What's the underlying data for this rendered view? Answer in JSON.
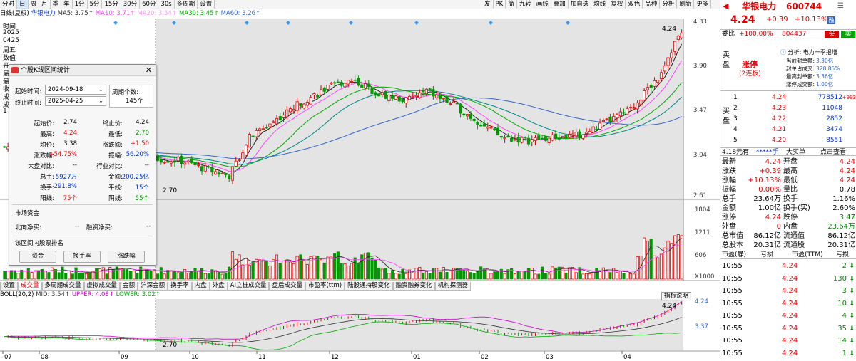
{
  "toolbar": {
    "left": [
      "分时",
      "日",
      "周",
      "月",
      "季",
      "年",
      "1分",
      "5分",
      "15分",
      "30分",
      "60分",
      "30s",
      "多周期",
      "设置"
    ],
    "right": [
      "发",
      "PK",
      "简",
      "九转",
      "画线",
      "叠加",
      "加自选",
      "均线",
      "复权",
      "双色",
      "品种",
      "分析",
      "刷新",
      "更多"
    ],
    "active": "日"
  },
  "ma_row": {
    "prefix": "日线(复权)",
    "name": "华银电力",
    "ma5": "MA5: 3.75↑",
    "ma10": "MA10: 3.71↑",
    "ma20": "MA20: 3.54↑",
    "ma30": "MA30: 3.45↑",
    "ma60": "MA60: 3.26↑"
  },
  "left_strip": [
    "时间",
    "2025",
    "0425",
    "周五",
    "数值",
    "开",
    "最",
    "最",
    "收",
    "成",
    "成",
    "1"
  ],
  "price_axis": [
    "4.33",
    "3.90",
    "3.47",
    "3.04",
    "2.61"
  ],
  "price_marks": {
    "high_label": "4.24",
    "low_label": "2.70"
  },
  "volume_axis": [
    "1804",
    "1211",
    "606"
  ],
  "volume_unit": "X1000",
  "boll_axis": [
    "4.24",
    "3.37"
  ],
  "boll_marks": {
    "high_label": "4.24",
    "low_label": "2.70",
    "help_button": "指标说明"
  },
  "months": [
    "07",
    "08",
    "09",
    "10",
    "11",
    "12",
    "01",
    "02",
    "03",
    "04"
  ],
  "tabs": [
    "设置",
    "成交量",
    "多周期成交量",
    "虚拟成交量",
    "金额",
    "沪深金额",
    "换手率",
    "内盘",
    "外盘",
    "AI立桩成交量",
    "盘后成交量",
    "市盈率(ttm)",
    "陆股通持股变化",
    "融资融券变化",
    "机构探测器"
  ],
  "active_tab": "成交量",
  "boll_row": {
    "name": "BOLL(20,2)",
    "mid": "MID: 3.54↑",
    "upper": "UPPER: 4.08↑",
    "lower": "LOWER: 3.02↑"
  },
  "dialog": {
    "title": "个股K线区间统计",
    "start_label": "起始时间:",
    "start_value": "2024-09-18",
    "end_label": "终止时间:",
    "end_value": "2025-04-25",
    "period_label": "周期个数:",
    "period_value": "145个",
    "stats": [
      {
        "l1": "起始价:",
        "v1": "2.74",
        "c1": "black",
        "l2": "终止价:",
        "v2": "4.24",
        "c2": "black"
      },
      {
        "l1": "最高:",
        "v1": "4.24",
        "c1": "red",
        "l2": "最低:",
        "v2": "2.70",
        "c2": "green"
      },
      {
        "l1": "均价:",
        "v1": "3.38",
        "c1": "black",
        "l2": "涨跌额:",
        "v2": "+1.50",
        "c2": "red"
      },
      {
        "l1": "涨跌幅:",
        "v1": "+54.75%",
        "c1": "red",
        "l2": "振幅:",
        "v2": "56.20%",
        "c2": "blue"
      },
      {
        "l1": "大盘对比:",
        "v1": "--",
        "c1": "black",
        "l2": "行业对比:",
        "v2": "--",
        "c2": "black"
      },
      {
        "l1": "总手:",
        "v1": "5927万",
        "c1": "blue",
        "l2": "金额:",
        "v2": "200.25亿",
        "c2": "blue"
      },
      {
        "l1": "换手:",
        "v1": "291.8%",
        "c1": "blue",
        "l2": "平线:",
        "v2": "15个",
        "c2": "blue"
      },
      {
        "l1": "阳线:",
        "v1": "75个",
        "c1": "red",
        "l2": "阴线:",
        "v2": "55个",
        "c2": "green"
      }
    ],
    "fund_title": "市场资金",
    "north_label": "北向净买:",
    "north_value": "--",
    "margin_label": "融资净买:",
    "margin_value": "--",
    "rank_title": "该区间内股票排名",
    "buttons": [
      "资金",
      "换手率",
      "涨跌幅"
    ]
  },
  "quote": {
    "name": "华银电力",
    "code": "600744",
    "price": "4.24",
    "change": "+0.39",
    "pct": "+10.13%",
    "tag": "融",
    "weibi_label": "委比",
    "weibi_value": "+100.00%",
    "weibi_vol": "804437",
    "buy_btn": "买",
    "sell_btn": "卖",
    "sell_side": "卖盘",
    "limit_status": "涨停",
    "limit_days": "(2连板)",
    "analysis_title": "分析: 电力一季报增",
    "limit_info": [
      {
        "k": "当前封单额:",
        "v": "3.30亿"
      },
      {
        "k": "封单占成交:",
        "v": "328.85%"
      },
      {
        "k": "最高封单额:",
        "v": "3.36亿"
      },
      {
        "k": "涨停成交额:",
        "v": "1.00亿"
      }
    ],
    "buy_side": "买盘",
    "bids": [
      {
        "n": "1",
        "p": "4.24",
        "v": "778512",
        "d": "+993"
      },
      {
        "n": "2",
        "p": "4.23",
        "v": "11048",
        "d": ""
      },
      {
        "n": "3",
        "p": "4.22",
        "v": "2852",
        "d": ""
      },
      {
        "n": "4",
        "p": "4.21",
        "v": "3474",
        "d": ""
      },
      {
        "n": "5",
        "p": "4.20",
        "v": "8551",
        "d": ""
      }
    ],
    "big_order": {
      "a": "4.18元有",
      "b": "*****手",
      "c": "大买单",
      "d": "点击查看"
    },
    "stats": [
      {
        "k1": "最新",
        "v1": "4.24",
        "c1": "red",
        "k2": "开盘",
        "v2": "4.24",
        "c2": "red"
      },
      {
        "k1": "涨跌",
        "v1": "+0.39",
        "c1": "red",
        "k2": "最高",
        "v2": "4.24",
        "c2": "red"
      },
      {
        "k1": "涨幅",
        "v1": "+10.13%",
        "c1": "red",
        "k2": "最低",
        "v2": "4.24",
        "c2": "red"
      },
      {
        "k1": "振幅",
        "v1": "0.00%",
        "c1": "red",
        "k2": "量比",
        "v2": "0.78",
        "c2": "black"
      },
      {
        "k1": "总手",
        "v1": "23.64万",
        "c1": "black",
        "k2": "换手",
        "v2": "1.16%",
        "c2": "black"
      },
      {
        "k1": "金额",
        "v1": "1.00亿",
        "c1": "black",
        "k2": "换手(实)",
        "v2": "2.60%",
        "c2": "black"
      },
      {
        "k1": "涨停",
        "v1": "4.24",
        "c1": "red",
        "k2": "跌停",
        "v2": "3.47",
        "c2": "green"
      },
      {
        "k1": "外盘",
        "v1": "0",
        "c1": "red",
        "k2": "内盘",
        "v2": "23.64万",
        "c2": "green"
      },
      {
        "k1": "总市值",
        "v1": "86.12亿",
        "c1": "black",
        "k2": "流通值",
        "v2": "86.12亿",
        "c2": "black"
      },
      {
        "k1": "总股本",
        "v1": "20.31亿",
        "c1": "black",
        "k2": "流通股",
        "v2": "20.31亿",
        "c2": "black"
      }
    ],
    "pe_header": {
      "a": "市盈(静)",
      "b": "亏损",
      "c": "市盈(TTM)",
      "d": "亏损"
    },
    "ticks": [
      {
        "t": "10:55",
        "p": "4.24",
        "v": "2",
        "c": "green"
      },
      {
        "t": "10:55",
        "p": "4.24",
        "v": "130",
        "c": "green"
      },
      {
        "t": "10:55",
        "p": "4.24",
        "v": "3",
        "c": "green"
      },
      {
        "t": "10:55",
        "p": "4.24",
        "v": "10",
        "c": "green"
      },
      {
        "t": "10:55",
        "p": "4.24",
        "v": "4",
        "c": "green"
      },
      {
        "t": "10:55",
        "p": "4.24",
        "v": "35",
        "c": "green"
      },
      {
        "t": "10:55",
        "p": "4.24",
        "v": "14",
        "c": "green"
      },
      {
        "t": "10:55",
        "p": "4.24",
        "v": "1",
        "c": "green"
      }
    ]
  },
  "colors": {
    "up": "#e00000",
    "down": "#009900",
    "ma5": "#222222",
    "ma10": "#ff44ff",
    "ma20": "#00aa00",
    "ma30": "#008888",
    "ma60": "#3366cc"
  }
}
